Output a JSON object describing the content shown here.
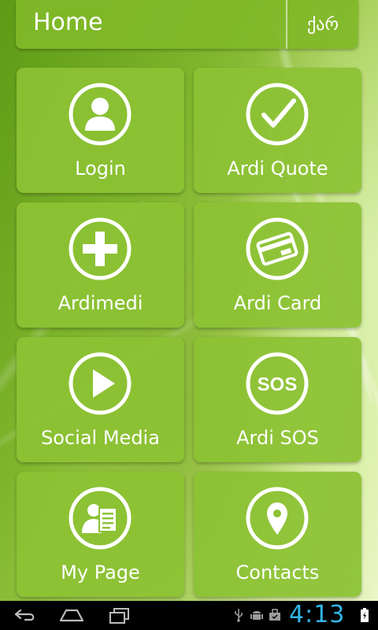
{
  "header": {
    "title": "Home",
    "language_label": "ქარ"
  },
  "tiles": [
    {
      "label": "Login",
      "icon": "user-icon"
    },
    {
      "label": "Ardi Quote",
      "icon": "checkmark-icon"
    },
    {
      "label": "Ardimedi",
      "icon": "plus-icon"
    },
    {
      "label": "Ardi Card",
      "icon": "card-icon"
    },
    {
      "label": "Social Media",
      "icon": "play-icon"
    },
    {
      "label": "Ardi SOS",
      "icon": "sos-icon",
      "icon_text": "SOS"
    },
    {
      "label": "My Page",
      "icon": "user-document-icon"
    },
    {
      "label": "Contacts",
      "icon": "location-pin-icon"
    }
  ],
  "system_bar": {
    "time": "4:13",
    "nav_icons": [
      "back-icon",
      "home-icon",
      "recents-icon"
    ],
    "status_icons": [
      "usb-icon",
      "android-debug-icon",
      "briefcase-icon",
      "battery-icon"
    ],
    "clock_color": "#33b5e5"
  },
  "colors": {
    "tile": "#8cc234",
    "header": "#80b828",
    "text": "#ffffff"
  }
}
